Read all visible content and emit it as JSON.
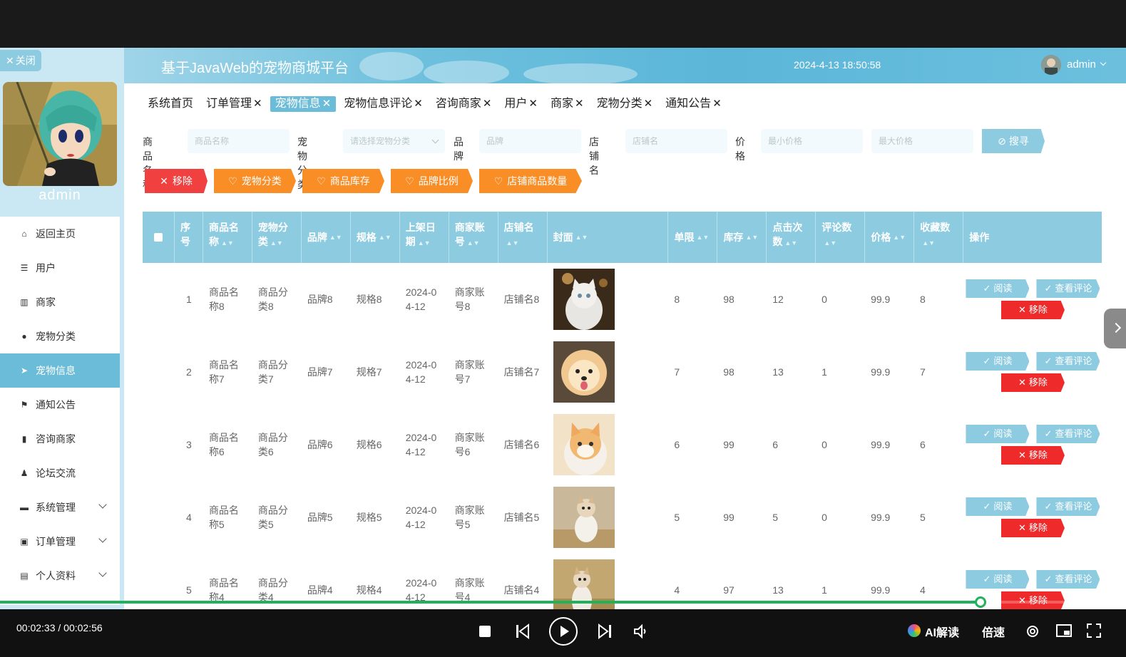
{
  "sidebar": {
    "close_label": "关闭",
    "admin_name": "admin",
    "menu": [
      {
        "label": "返回主页",
        "icon": "home-icon"
      },
      {
        "label": "用户",
        "icon": "sliders-icon"
      },
      {
        "label": "商家",
        "icon": "chart-icon"
      },
      {
        "label": "宠物分类",
        "icon": "pin-icon"
      },
      {
        "label": "宠物信息",
        "icon": "send-icon",
        "active": true
      },
      {
        "label": "通知公告",
        "icon": "flag-icon"
      },
      {
        "label": "咨询商家",
        "icon": "bar-chart-icon"
      },
      {
        "label": "论坛交流",
        "icon": "user-icon"
      },
      {
        "label": "系统管理",
        "icon": "monitor-icon"
      },
      {
        "label": "订单管理",
        "icon": "clipboard-icon"
      },
      {
        "label": "个人资料",
        "icon": "profile-icon"
      }
    ]
  },
  "header": {
    "title": "基于JavaWeb的宠物商城平台",
    "clock": "2024-4-13 18:50:58",
    "user": "admin"
  },
  "tabs": [
    "系统首页",
    "订单管理",
    "宠物信息",
    "宠物信息评论",
    "咨询商家",
    "用户",
    "商家",
    "宠物分类",
    "通知公告"
  ],
  "search": {
    "name_label": "商品名称",
    "name_placeholder": "商品名称",
    "category_label": "宠物分类",
    "category_placeholder": "请选择宠物分类",
    "brand_label": "品牌",
    "brand_placeholder": "品牌",
    "shop_label": "店铺名",
    "shop_placeholder": "店铺名",
    "price_label": "价格",
    "min_placeholder": "最小价格",
    "max_placeholder": "最大价格",
    "button": "搜寻"
  },
  "actions": {
    "remove": "移除",
    "category": "宠物分类",
    "stock": "商品库存",
    "brand_ratio": "品牌比例",
    "shop_count": "店铺商品数量"
  },
  "table": {
    "headers": {
      "index": "序号",
      "name": "商品名称",
      "category": "宠物分类",
      "brand": "品牌",
      "spec": "规格",
      "date": "上架日期",
      "account": "商家账号",
      "shop": "店铺名",
      "cover": "封面",
      "limit": "单限",
      "stock": "库存",
      "clicks": "点击次数",
      "comments": "评论数",
      "price": "价格",
      "favs": "收藏数",
      "ops": "操作"
    },
    "rows": [
      {
        "index": "1",
        "name": "商品名称8",
        "category": "商品分类8",
        "brand": "品牌8",
        "spec": "规格8",
        "date": "2024-04-12",
        "account": "商家账号8",
        "shop": "店铺名8",
        "limit": "8",
        "stock": "98",
        "clicks": "12",
        "comments": "0",
        "price": "99.9",
        "favs": "8"
      },
      {
        "index": "2",
        "name": "商品名称7",
        "category": "商品分类7",
        "brand": "品牌7",
        "spec": "规格7",
        "date": "2024-04-12",
        "account": "商家账号7",
        "shop": "店铺名7",
        "limit": "7",
        "stock": "98",
        "clicks": "13",
        "comments": "1",
        "price": "99.9",
        "favs": "7"
      },
      {
        "index": "3",
        "name": "商品名称6",
        "category": "商品分类6",
        "brand": "品牌6",
        "spec": "规格6",
        "date": "2024-04-12",
        "account": "商家账号6",
        "shop": "店铺名6",
        "limit": "6",
        "stock": "99",
        "clicks": "6",
        "comments": "0",
        "price": "99.9",
        "favs": "6"
      },
      {
        "index": "4",
        "name": "商品名称5",
        "category": "商品分类5",
        "brand": "品牌5",
        "spec": "规格5",
        "date": "2024-04-12",
        "account": "商家账号5",
        "shop": "店铺名5",
        "limit": "5",
        "stock": "99",
        "clicks": "5",
        "comments": "0",
        "price": "99.9",
        "favs": "5"
      },
      {
        "index": "5",
        "name": "商品名称4",
        "category": "商品分类4",
        "brand": "品牌4",
        "spec": "规格4",
        "date": "2024-04-12",
        "account": "商家账号4",
        "shop": "店铺名4",
        "limit": "4",
        "stock": "97",
        "clicks": "13",
        "comments": "1",
        "price": "99.9",
        "favs": "4"
      }
    ],
    "op_read": "阅读",
    "op_comments": "查看评论",
    "op_remove": "移除"
  },
  "player": {
    "time": "00:02:33 / 00:02:56",
    "progress": 0.8705,
    "ai_label": "AI解读",
    "speed_label": "倍速"
  }
}
